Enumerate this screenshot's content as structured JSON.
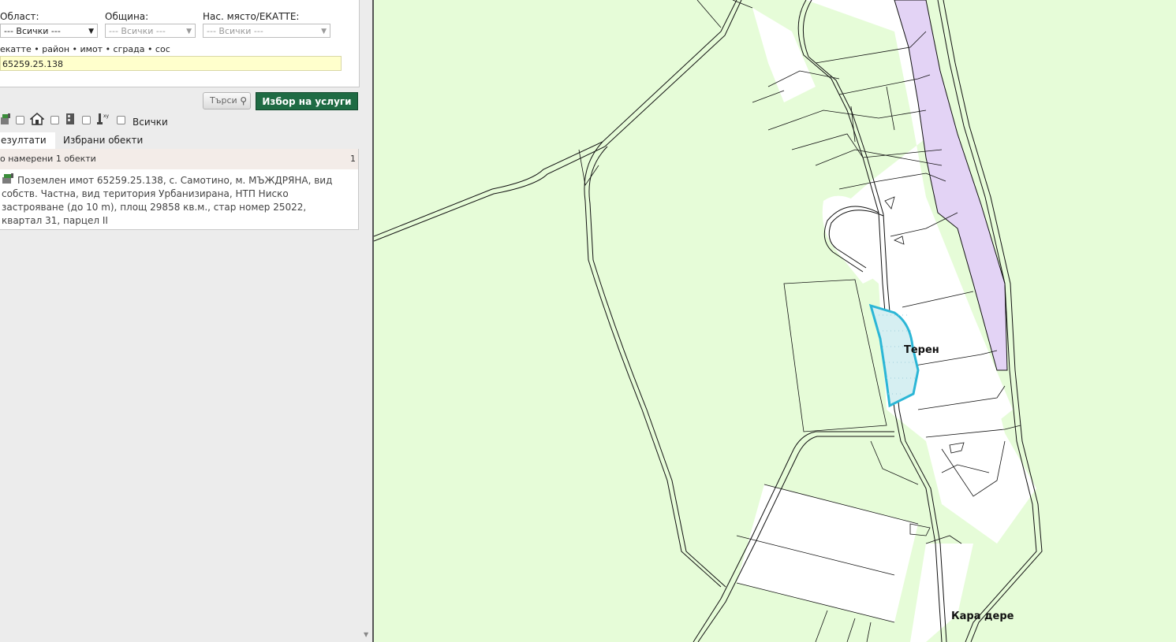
{
  "search": {
    "region_label": "Област:",
    "region_value": "--- Всички ---",
    "municipality_label": "Община:",
    "municipality_value": "--- Всички ---",
    "settlement_label": "Нас. място/ЕКАТТЕ:",
    "settlement_value": "--- Всички ---",
    "hint": "екатте • район • имот • сграда • сос",
    "query_value": "65259.25.138",
    "search_button": "Търси",
    "services_button": "Избор на услуги",
    "filter_all_label": "Всички"
  },
  "tabs": {
    "results": "езултати",
    "selected": "Избрани обекти"
  },
  "results": {
    "summary": "о намерени 1 обекти",
    "count": "1",
    "item_text": "Поземлен имот 65259.25.138, с. Самотино, м. МЪЖДРЯНА, вид собств. Частна, вид територия Урбанизирана, НТП Ниско застрояване (до 10 m), площ 29858 кв.м., стар номер 25022, квартал 31, парцел II"
  },
  "map": {
    "labels": {
      "teren": "Терен",
      "kara_dere": "Кара дере"
    },
    "colors": {
      "land": "#e6fcd8",
      "urban": "#ffffff",
      "shore": "#e3d3f5",
      "highlight": "#2bb6d6",
      "line": "#111111"
    }
  },
  "icons": {
    "parcel": "parcel-icon",
    "building": "building-icon",
    "apartment": "apartment-icon",
    "coordinate": "coordinate-point-icon",
    "search": "magnifier-icon"
  }
}
